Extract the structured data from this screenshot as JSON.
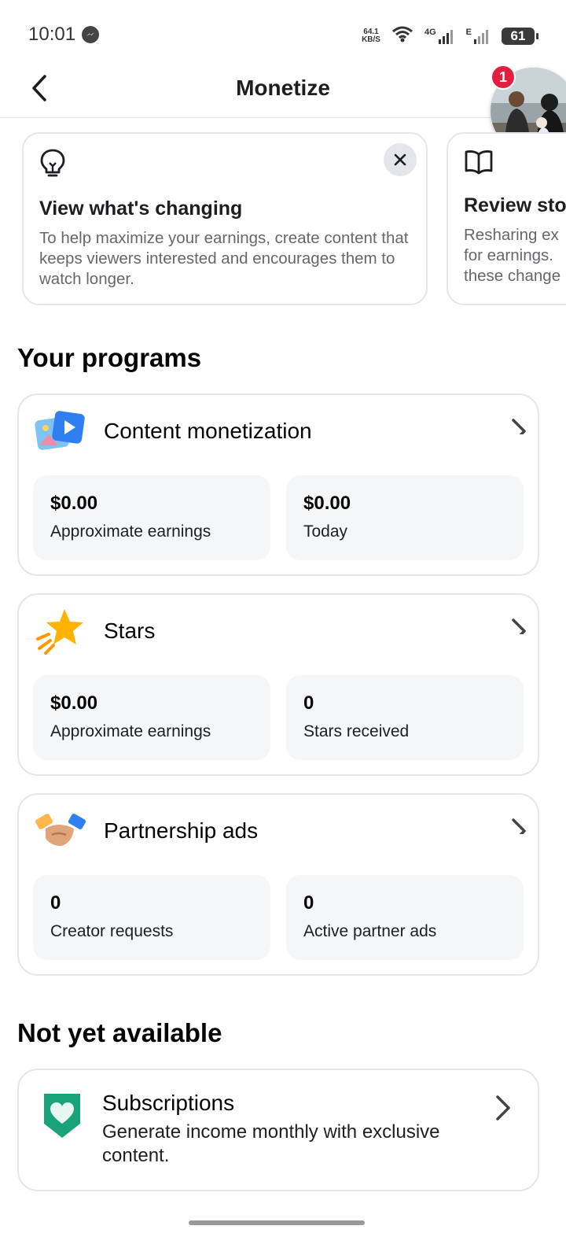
{
  "status_bar": {
    "time": "10:01",
    "net_speed_value": "64.1",
    "net_speed_unit": "KB/S",
    "sim1_label": "4G",
    "sim2_label": "E",
    "battery": "61"
  },
  "header": {
    "title": "Monetize",
    "notification_count": "1"
  },
  "tips": [
    {
      "icon": "lightbulb-icon",
      "title": "View what's changing",
      "text": "To help maximize your earnings, create content that keeps viewers interested and encourages them to watch longer."
    },
    {
      "icon": "book-icon",
      "title": "Review stor",
      "text": "Resharing ex for earnings. these change"
    }
  ],
  "programs_heading": "Your programs",
  "programs": [
    {
      "name": "Content monetization",
      "icon": "content-media-icon",
      "stats": [
        {
          "value": "$0.00",
          "label": "Approximate earnings"
        },
        {
          "value": "$0.00",
          "label": "Today"
        }
      ]
    },
    {
      "name": "Stars",
      "icon": "star-icon",
      "stats": [
        {
          "value": "$0.00",
          "label": "Approximate earnings"
        },
        {
          "value": "0",
          "label": "Stars received"
        }
      ]
    },
    {
      "name": "Partnership ads",
      "icon": "handshake-icon",
      "stats": [
        {
          "value": "0",
          "label": "Creator requests"
        },
        {
          "value": "0",
          "label": "Active partner ads"
        }
      ]
    }
  ],
  "not_available_heading": "Not yet available",
  "subscriptions": {
    "name": "Subscriptions",
    "description": "Generate income monthly with exclusive content.",
    "icon": "heart-badge-icon"
  },
  "colors": {
    "badge": "#e41e3f",
    "card_border": "#e4e6eb",
    "stat_bg": "#f5f6f8",
    "subscriptions_green": "#1aa37a"
  }
}
